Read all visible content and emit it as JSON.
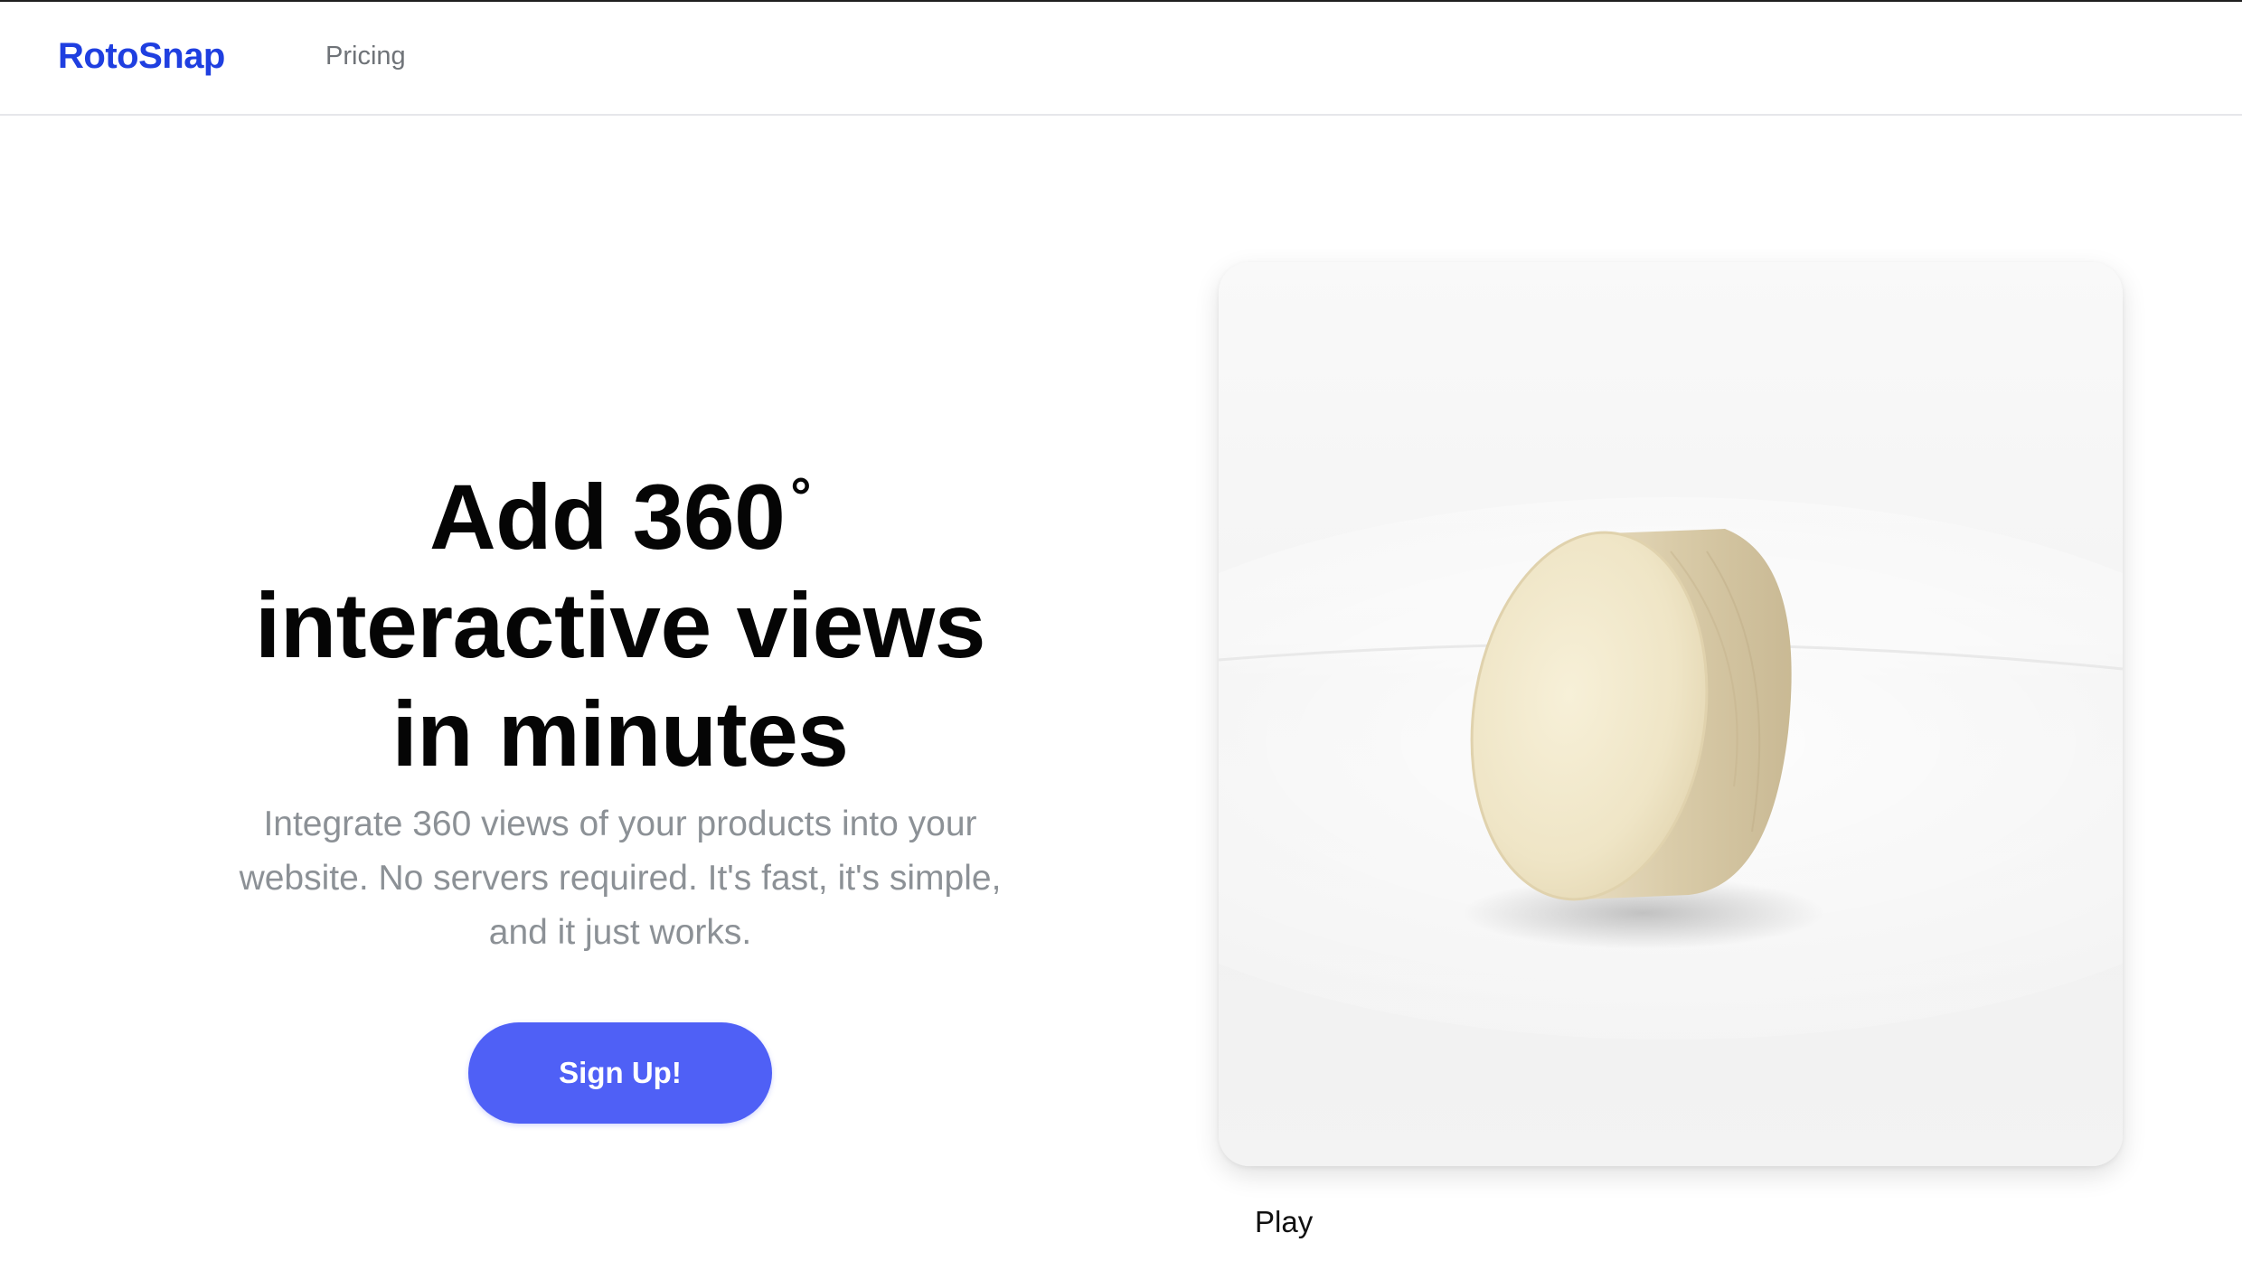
{
  "nav": {
    "logo": "RotoSnap",
    "links": [
      {
        "label": "Pricing"
      }
    ]
  },
  "hero": {
    "title_line1": "Add 360",
    "title_degree": "°",
    "title_line2": "interactive views",
    "title_line3": "in minutes",
    "subtitle_line1": "Integrate 360 views of your products into your",
    "subtitle_line2": "website. No servers required. It's fast, it's simple,",
    "subtitle_line3": "and it just works.",
    "cta_label": "Sign Up!"
  },
  "viewer": {
    "product_image": "cylindrical-wheel-product-photo",
    "play_label": "Play"
  },
  "colors": {
    "brand": "#1f3fe0",
    "cta": "#4f60f6",
    "heading": "#050505",
    "muted": "#8c9196",
    "nav_link": "#6f7378"
  }
}
